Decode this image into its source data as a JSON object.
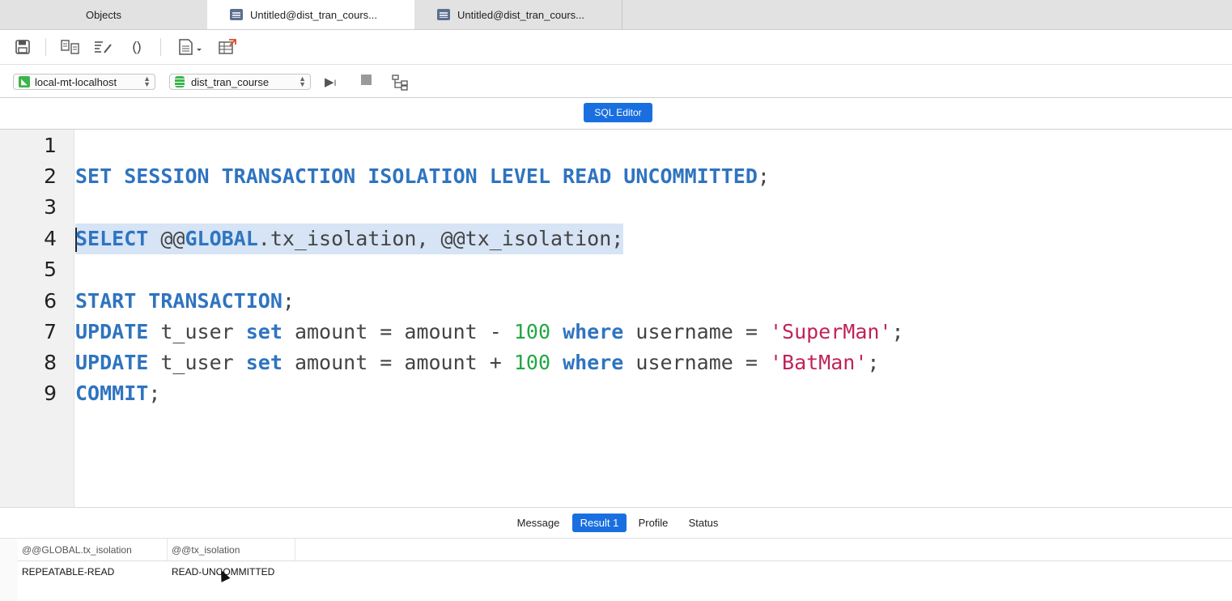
{
  "tabs": [
    {
      "label": "Objects"
    },
    {
      "label": "Untitled@dist_tran_cours..."
    },
    {
      "label": "Untitled@dist_tran_cours..."
    }
  ],
  "toolbar": {
    "icons": [
      "save-icon",
      "query-builder-icon",
      "beautify-icon",
      "code-snippet-icon",
      "text-menu-icon",
      "export-icon"
    ],
    "code_snippet_glyph": "()"
  },
  "connection": {
    "value": "local-mt-localhost"
  },
  "database": {
    "value": "dist_tran_course"
  },
  "mode": {
    "label": "SQL Editor"
  },
  "editor": {
    "line_numbers": [
      "1",
      "2",
      "3",
      "4",
      "5",
      "6",
      "7",
      "8",
      "9"
    ],
    "lines": [
      "",
      "SET SESSION TRANSACTION ISOLATION LEVEL READ UNCOMMITTED;",
      "",
      "SELECT @@GLOBAL.tx_isolation, @@tx_isolation;",
      "",
      "START TRANSACTION;",
      "UPDATE t_user set amount = amount - 100 where username = 'SuperMan';",
      "UPDATE t_user set amount = amount + 100 where username = 'BatMan';",
      "COMMIT;"
    ],
    "tokens": {
      "l2_kw": "SET SESSION TRANSACTION ISOLATION LEVEL READ UNCOMMITTED",
      "semi": ";",
      "l4_kw1": "SELECT",
      "l4_mid1": " @@",
      "l4_kw2": "GLOBAL",
      "l4_rest": ".tx_isolation, @@tx_isolation;",
      "l6_kw": "START TRANSACTION",
      "update": "UPDATE",
      "t_user": " t_user ",
      "set": "set",
      "amount_minus": " amount = amount - ",
      "amount_plus": " amount = amount + ",
      "num": "100",
      "where": " where",
      "username_eq": " username = ",
      "str_superman": "'SuperMan'",
      "str_batman": "'BatMan'",
      "commit": "COMMIT"
    }
  },
  "results": {
    "tabs": [
      "Message",
      "Result 1",
      "Profile",
      "Status"
    ],
    "active_tab": "Result 1",
    "columns": [
      "@@GLOBAL.tx_isolation",
      "@@tx_isolation"
    ],
    "rows": [
      [
        "REPEATABLE-READ",
        "READ-UNCOMMITTED"
      ]
    ]
  },
  "colors": {
    "accent": "#1a6fe0",
    "keyword": "#2f74c0",
    "number": "#21a845",
    "string": "#c0225a",
    "selection": "#d6e4f5"
  }
}
